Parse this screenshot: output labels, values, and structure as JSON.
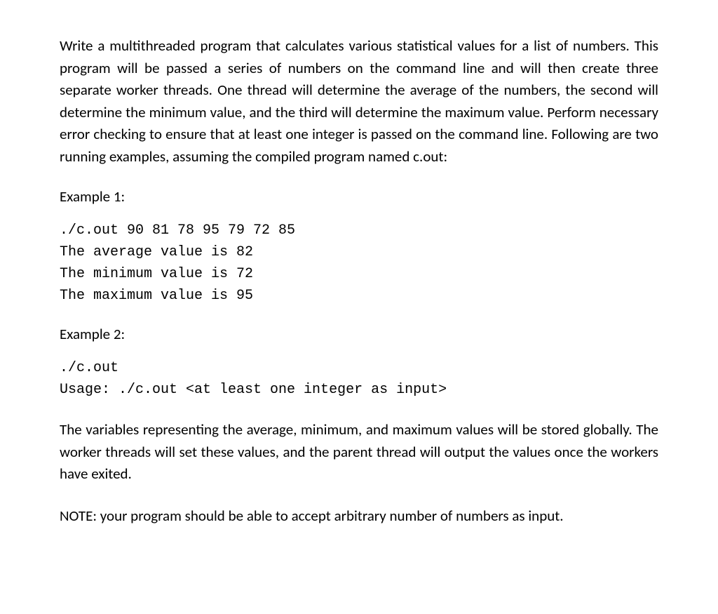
{
  "problem": {
    "statement": "Write a multithreaded program that calculates various statistical values for a list of numbers. This program will be passed a series of numbers on the command line and will then create three separate worker threads. One thread will determine the average of the numbers, the second will determine the minimum value, and the third will determine the maximum value. Perform necessary error checking to ensure that at least one integer is passed on the command line. Following are two running examples, assuming the compiled program named c.out:"
  },
  "example1": {
    "label": "Example 1:",
    "code": "./c.out 90 81 78 95 79 72 85\nThe average value is 82\nThe minimum value is 72\nThe maximum value is 95"
  },
  "example2": {
    "label": "Example 2:",
    "code": "./c.out\nUsage: ./c.out <at least one integer as input>"
  },
  "explanation": "The variables representing the average, minimum, and maximum values will be stored globally. The worker threads will set these values, and the parent thread will output the values once the workers have exited.",
  "note": "NOTE: your program should be able to accept arbitrary number of numbers as input."
}
